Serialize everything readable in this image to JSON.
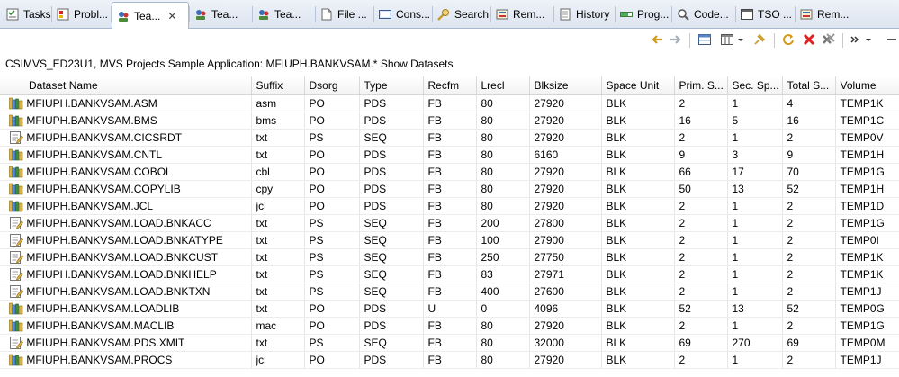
{
  "tabs": [
    {
      "label": "Tasks",
      "icon": "tasks-icon"
    },
    {
      "label": "Probl...",
      "icon": "problems-icon"
    },
    {
      "label": "Tea...",
      "icon": "team-icon",
      "active": true
    },
    {
      "label": "Tea...",
      "icon": "team-icon"
    },
    {
      "label": "Tea...",
      "icon": "team-icon"
    },
    {
      "label": "File ...",
      "icon": "file-icon"
    },
    {
      "label": "Cons...",
      "icon": "console-icon"
    },
    {
      "label": "Search",
      "icon": "search-icon"
    },
    {
      "label": "Rem...",
      "icon": "remote-icon"
    },
    {
      "label": "History",
      "icon": "history-icon"
    },
    {
      "label": "Prog...",
      "icon": "progress-icon"
    },
    {
      "label": "Code...",
      "icon": "code-icon"
    },
    {
      "label": "TSO ...",
      "icon": "tso-icon"
    },
    {
      "label": "Rem...",
      "icon": "remote-icon"
    }
  ],
  "description": "CSIMVS_ED23U1, MVS Projects Sample Application: MFIUPH.BANKVSAM.* Show Datasets",
  "columns": [
    "Dataset Name",
    "Suffix",
    "Dsorg",
    "Type",
    "Recfm",
    "Lrecl",
    "Blksize",
    "Space Unit",
    "Prim. S...",
    "Sec. Sp...",
    "Total S...",
    "Volume"
  ],
  "rows": [
    [
      "MFIUPH.BANKVSAM.ASM",
      "asm",
      "PO",
      "PDS",
      "FB",
      "80",
      "27920",
      "BLK",
      "2",
      "1",
      "4",
      "TEMP1K"
    ],
    [
      "MFIUPH.BANKVSAM.BMS",
      "bms",
      "PO",
      "PDS",
      "FB",
      "80",
      "27920",
      "BLK",
      "16",
      "5",
      "16",
      "TEMP1C"
    ],
    [
      "MFIUPH.BANKVSAM.CICSRDT",
      "txt",
      "PS",
      "SEQ",
      "FB",
      "80",
      "27920",
      "BLK",
      "2",
      "1",
      "2",
      "TEMP0V"
    ],
    [
      "MFIUPH.BANKVSAM.CNTL",
      "txt",
      "PO",
      "PDS",
      "FB",
      "80",
      "6160",
      "BLK",
      "9",
      "3",
      "9",
      "TEMP1H"
    ],
    [
      "MFIUPH.BANKVSAM.COBOL",
      "cbl",
      "PO",
      "PDS",
      "FB",
      "80",
      "27920",
      "BLK",
      "66",
      "17",
      "70",
      "TEMP1G"
    ],
    [
      "MFIUPH.BANKVSAM.COPYLIB",
      "cpy",
      "PO",
      "PDS",
      "FB",
      "80",
      "27920",
      "BLK",
      "50",
      "13",
      "52",
      "TEMP1H"
    ],
    [
      "MFIUPH.BANKVSAM.JCL",
      "jcl",
      "PO",
      "PDS",
      "FB",
      "80",
      "27920",
      "BLK",
      "2",
      "1",
      "2",
      "TEMP1D"
    ],
    [
      "MFIUPH.BANKVSAM.LOAD.BNKACC",
      "txt",
      "PS",
      "SEQ",
      "FB",
      "200",
      "27800",
      "BLK",
      "2",
      "1",
      "2",
      "TEMP1G"
    ],
    [
      "MFIUPH.BANKVSAM.LOAD.BNKATYPE",
      "txt",
      "PS",
      "SEQ",
      "FB",
      "100",
      "27900",
      "BLK",
      "2",
      "1",
      "2",
      "TEMP0I"
    ],
    [
      "MFIUPH.BANKVSAM.LOAD.BNKCUST",
      "txt",
      "PS",
      "SEQ",
      "FB",
      "250",
      "27750",
      "BLK",
      "2",
      "1",
      "2",
      "TEMP1K"
    ],
    [
      "MFIUPH.BANKVSAM.LOAD.BNKHELP",
      "txt",
      "PS",
      "SEQ",
      "FB",
      "83",
      "27971",
      "BLK",
      "2",
      "1",
      "2",
      "TEMP1K"
    ],
    [
      "MFIUPH.BANKVSAM.LOAD.BNKTXN",
      "txt",
      "PS",
      "SEQ",
      "FB",
      "400",
      "27600",
      "BLK",
      "2",
      "1",
      "2",
      "TEMP1J"
    ],
    [
      "MFIUPH.BANKVSAM.LOADLIB",
      "txt",
      "PO",
      "PDS",
      "U",
      "0",
      "4096",
      "BLK",
      "52",
      "13",
      "52",
      "TEMP0G"
    ],
    [
      "MFIUPH.BANKVSAM.MACLIB",
      "mac",
      "PO",
      "PDS",
      "FB",
      "80",
      "27920",
      "BLK",
      "2",
      "1",
      "2",
      "TEMP1G"
    ],
    [
      "MFIUPH.BANKVSAM.PDS.XMIT",
      "txt",
      "PS",
      "SEQ",
      "FB",
      "80",
      "32000",
      "BLK",
      "69",
      "270",
      "69",
      "TEMP0M"
    ],
    [
      "MFIUPH.BANKVSAM.PROCS",
      "jcl",
      "PO",
      "PDS",
      "FB",
      "80",
      "27920",
      "BLK",
      "2",
      "1",
      "2",
      "TEMP1J"
    ]
  ],
  "row_icons": [
    "library-icon",
    "library-icon",
    "sequential-dataset-icon",
    "library-icon",
    "library-icon",
    "library-icon",
    "library-icon",
    "sequential-dataset-icon",
    "sequential-dataset-icon",
    "sequential-dataset-icon",
    "sequential-dataset-icon",
    "sequential-dataset-icon",
    "library-icon",
    "library-icon",
    "sequential-dataset-icon",
    "library-icon"
  ],
  "colors": {
    "tab_bg": "#dde5f0",
    "border": "#a9b7cf",
    "library": "#c8a83a",
    "header_bg": "#f2f2f2"
  }
}
